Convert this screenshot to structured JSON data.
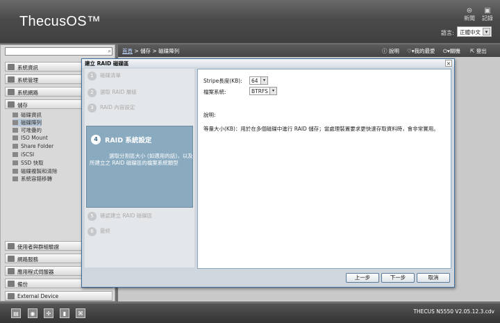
{
  "header": {
    "logo": "ThecusOS™",
    "news_label": "新聞",
    "log_label": "記錄",
    "language_label": "語言:",
    "language_value": "正體中文"
  },
  "sidebar": {
    "categories": [
      {
        "label": "系統資訊"
      },
      {
        "label": "系統管理"
      },
      {
        "label": "系統網路"
      },
      {
        "label": "儲存"
      }
    ],
    "storage_items": [
      {
        "label": "磁碟資訊"
      },
      {
        "label": "磁碟陣列"
      },
      {
        "label": "可堆疊的"
      },
      {
        "label": "ISO Mount"
      },
      {
        "label": "Share Folder"
      },
      {
        "label": "iSCSI"
      },
      {
        "label": "SSD 快取"
      },
      {
        "label": "磁碟複製和清除"
      },
      {
        "label": "系統容錯移轉"
      }
    ],
    "bottom_categories": [
      {
        "label": "使用者與群組驗證"
      },
      {
        "label": "網路服務"
      },
      {
        "label": "應用程式伺服器"
      },
      {
        "label": "備份"
      },
      {
        "label": "External Device"
      }
    ]
  },
  "topbar": {
    "breadcrumb": [
      "首頁",
      "儲存",
      "磁碟陣列"
    ],
    "breadcrumb_sep": " > ",
    "help_label": "說明",
    "favorites_label": "我的最愛",
    "shutdown_label": "關機",
    "logout_label": "登出"
  },
  "footer": {
    "version": "THECUS N5550 V2.05.12.3.cdv"
  },
  "dialog": {
    "title": "建立 RAID 磁碟區",
    "close": "×",
    "steps": [
      {
        "num": "1",
        "label": "磁碟清單"
      },
      {
        "num": "2",
        "label": "選取 RAID 層級"
      },
      {
        "num": "3",
        "label": "RAID 內容設定"
      },
      {
        "num": "4",
        "label": "RAID 系統設定",
        "desc": "選取分割區大小 (如適用的話)，以及所建立之 RAID 磁碟區的檔案系統類型"
      },
      {
        "num": "5",
        "label": "確認建立 RAID 磁碟區"
      },
      {
        "num": "6",
        "label": "最終"
      }
    ],
    "stripe_label": "Stripe長度(KB):",
    "stripe_value": "64",
    "fs_label": "檔案系統:",
    "fs_value": "BTRFS",
    "desc_title": "說明:",
    "desc_text": "等量大小(KB)：用於在多個磁碟中進行 RAID 儲存；當處理裝置要求更快速存取資料時，會非常實用。",
    "buttons": {
      "prev": "上一步",
      "next": "下一步",
      "cancel": "取消"
    }
  }
}
